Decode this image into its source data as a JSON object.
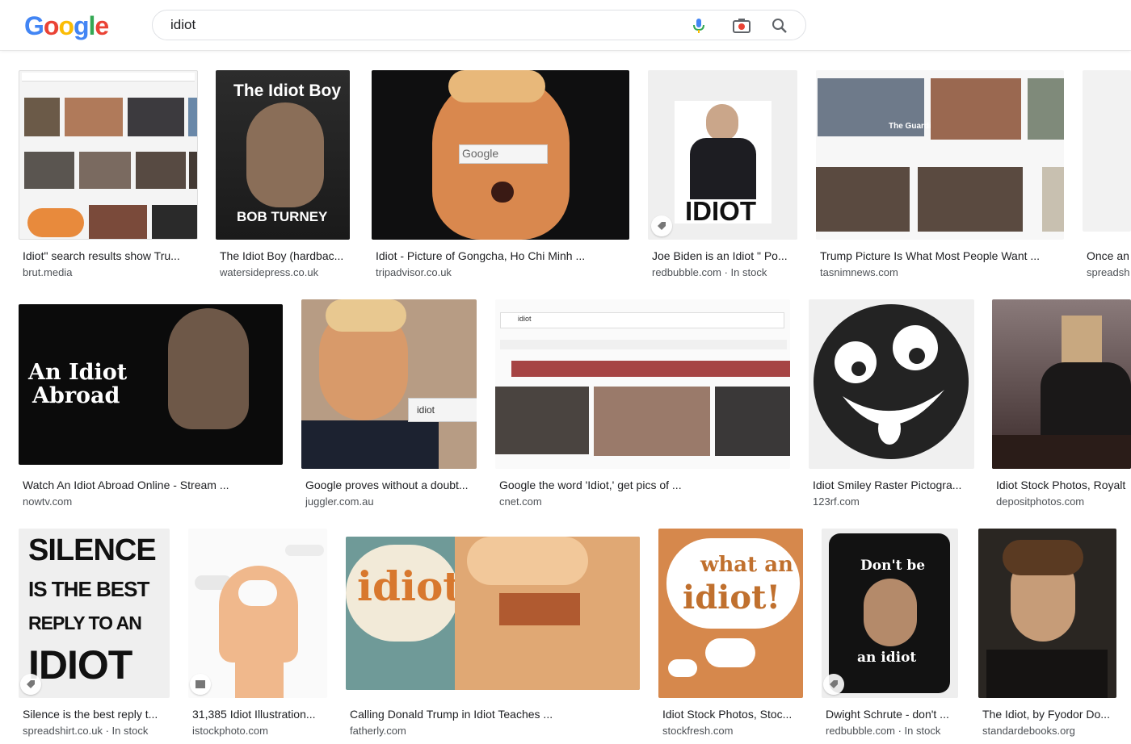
{
  "header": {
    "logo_letters": [
      "G",
      "o",
      "o",
      "g",
      "l",
      "e"
    ],
    "logo_colors": [
      "#4285F4",
      "#EA4335",
      "#FBBC05",
      "#4285F4",
      "#34A853",
      "#EA4335"
    ],
    "search_value": "idiot",
    "icons": [
      "microphone-icon",
      "camera-icon",
      "search-icon"
    ]
  },
  "results": [
    {
      "title": "Idiot\" search results show Tru...",
      "source": "brut.media",
      "thumb_text": ""
    },
    {
      "title": "The Idiot Boy (hardbac...",
      "source": "watersidepress.co.uk",
      "thumb_text": "The Idiot Boy",
      "thumb_text2": "BOB TURNEY"
    },
    {
      "title": "Idiot - Picture of Gongcha, Ho Chi Minh ...",
      "source": "tripadvisor.co.uk",
      "thumb_text": "Google"
    },
    {
      "title": "Joe Biden is an Idiot \" Po...",
      "source": "redbubble.com · In stock",
      "thumb_text": "IDIOT"
    },
    {
      "title": "Trump Picture Is What Most People Want ...",
      "source": "tasnimnews.com",
      "thumb_text": "The Guardian"
    },
    {
      "title": "Once an",
      "source": "spreadsh",
      "thumb_text": ""
    },
    {
      "title": "Watch An Idiot Abroad Online - Stream ...",
      "source": "nowtv.com",
      "thumb_text": "An Idiot",
      "thumb_text2": "Abroad"
    },
    {
      "title": "Google proves without a doubt...",
      "source": "juggler.com.au",
      "thumb_text": "idiot"
    },
    {
      "title": "Google the word 'Idiot,' get pics of ...",
      "source": "cnet.com",
      "thumb_text": "idiot"
    },
    {
      "title": "Idiot Smiley Raster Pictogra...",
      "source": "123rf.com",
      "thumb_text": ""
    },
    {
      "title": "Idiot Stock Photos, Royalt",
      "source": "depositphotos.com",
      "thumb_text": ""
    },
    {
      "title": "Silence is the best reply t...",
      "source": "spreadshirt.co.uk · In stock",
      "thumb_text": "SILENCE",
      "thumb_text2": "IS THE BEST",
      "thumb_text3": "REPLY TO AN",
      "thumb_text4": "IDIOT"
    },
    {
      "title": "31,385 Idiot Illustration...",
      "source": "istockphoto.com",
      "thumb_text": ""
    },
    {
      "title": "Calling Donald Trump in Idiot Teaches ...",
      "source": "fatherly.com",
      "thumb_text": "idiot"
    },
    {
      "title": "Idiot Stock Photos, Stoc...",
      "source": "stockfresh.com",
      "thumb_text": "what an",
      "thumb_text2": "idiot!"
    },
    {
      "title": "Dwight Schrute - don't ...",
      "source": "redbubble.com · In stock",
      "thumb_text": "Don't be",
      "thumb_text2": "an idiot"
    },
    {
      "title": "The Idiot, by Fyodor Do...",
      "source": "standardebooks.org",
      "thumb_text": ""
    }
  ]
}
